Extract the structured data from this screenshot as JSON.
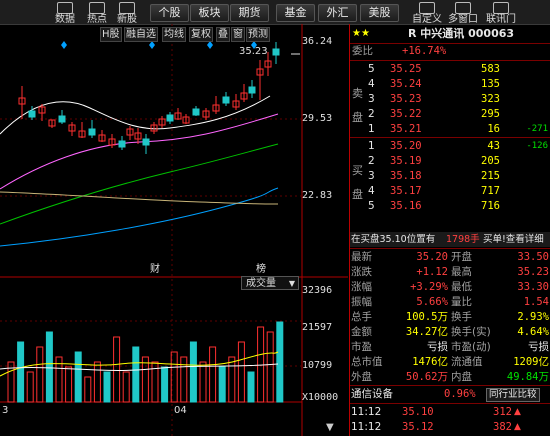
{
  "toolbar": {
    "left_buttons": [
      {
        "label": "数据",
        "icon": "data-icon"
      },
      {
        "label": "热点",
        "icon": "hotspot-icon"
      },
      {
        "label": "新股",
        "icon": "new-stock-icon"
      }
    ],
    "tabs": [
      "个股",
      "板块",
      "期货",
      "基金",
      "外汇",
      "美股"
    ],
    "right_buttons": [
      {
        "label": "自定义",
        "icon": "custom-icon"
      },
      {
        "label": "多窗口",
        "icon": "multi-window-icon"
      },
      {
        "label": "联讯门",
        "icon": "portal-icon"
      }
    ]
  },
  "chart": {
    "indicators": [
      "H股",
      "融自选",
      "均线",
      "复权",
      "叠",
      "窗",
      "预测"
    ],
    "price_labels": [
      "36.24",
      "29.53",
      "22.83"
    ],
    "high_marker": "35.23",
    "event_markers": [
      "财",
      "榜"
    ],
    "volume_dropdown": "成交量",
    "volume_labels": [
      "32396",
      "21597",
      "10799",
      "X10000"
    ],
    "date_labels": [
      "3",
      "04"
    ],
    "ma_colors": [
      "#ffffff",
      "#ff66ff",
      "#00c000",
      "#00a0ff",
      "#c8b478"
    ],
    "up_color": "#ff3030",
    "down_color": "#20c8c8"
  },
  "quote": {
    "title": "R 中兴通讯 000063",
    "stars": "★★",
    "weibi_label": "委比",
    "weibi_value": "+16.74%",
    "sell_label": [
      "卖",
      "盘"
    ],
    "buy_label": [
      "买",
      "盘"
    ],
    "sell": [
      {
        "level": "5",
        "price": "35.25",
        "vol": "583",
        "chg": ""
      },
      {
        "level": "4",
        "price": "35.24",
        "vol": "135",
        "chg": ""
      },
      {
        "level": "3",
        "price": "35.23",
        "vol": "323",
        "chg": ""
      },
      {
        "level": "2",
        "price": "35.22",
        "vol": "295",
        "chg": ""
      },
      {
        "level": "1",
        "price": "35.21",
        "vol": "16",
        "chg": "-271"
      }
    ],
    "buy": [
      {
        "level": "1",
        "price": "35.20",
        "vol": "43",
        "chg": "-126"
      },
      {
        "level": "2",
        "price": "35.19",
        "vol": "205",
        "chg": ""
      },
      {
        "level": "3",
        "price": "35.18",
        "vol": "215",
        "chg": ""
      },
      {
        "level": "4",
        "price": "35.17",
        "vol": "717",
        "chg": ""
      },
      {
        "level": "5",
        "price": "35.16",
        "vol": "716",
        "chg": ""
      }
    ],
    "notice_left": "在买盘35.10位置有",
    "notice_mid": "1798手",
    "notice_right": "买单!查看详细",
    "stats": [
      [
        "最新",
        "35.20",
        "开盘",
        "33.50"
      ],
      [
        "涨跌",
        "+1.12",
        "最高",
        "35.23"
      ],
      [
        "涨幅",
        "+3.29%",
        "最低",
        "33.30"
      ],
      [
        "振幅",
        "5.66%",
        "量比",
        "1.54"
      ],
      [
        "总手",
        "100.5万",
        "换手",
        "2.93%"
      ],
      [
        "金额",
        "34.27亿",
        "换手(实)",
        "4.64%"
      ],
      [
        "市盈",
        "亏损",
        "市盈(动)",
        "亏损"
      ],
      [
        "总市值",
        "1476亿",
        "流通值",
        "1209亿"
      ],
      [
        "外盘",
        "50.62万",
        "内盘",
        "49.84万"
      ]
    ],
    "sector_name": "通信设备",
    "sector_change": "0.96%",
    "sector_button": "同行业比较",
    "ticks": [
      {
        "time": "11:12",
        "price": "35.10",
        "vol": "312"
      },
      {
        "time": "11:12",
        "price": "35.12",
        "vol": "382"
      }
    ]
  }
}
